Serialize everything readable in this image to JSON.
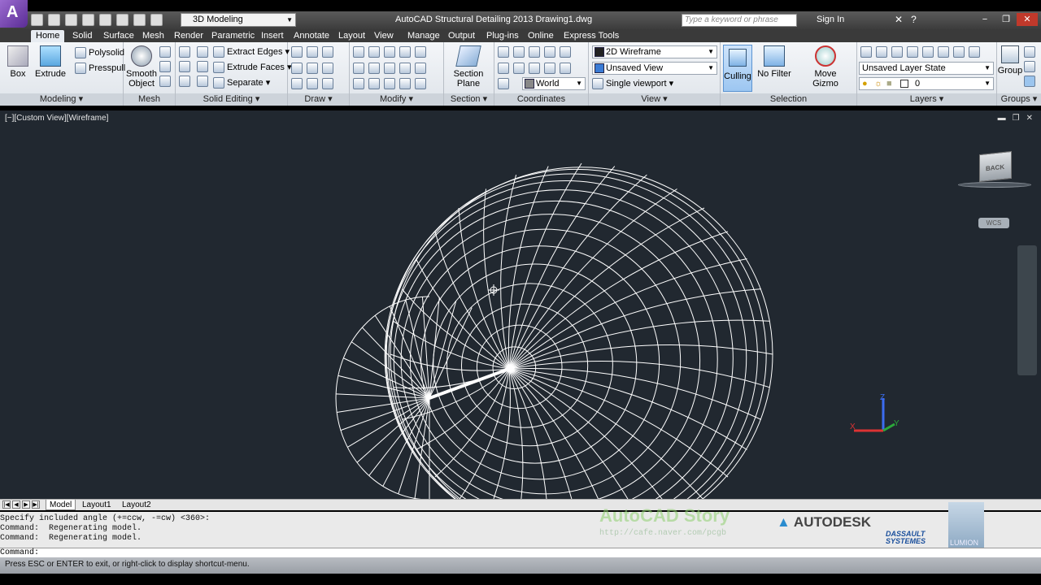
{
  "title_bar": {
    "logo": "A",
    "workspace": "3D Modeling",
    "app_title": "AutoCAD Structural Detailing 2013      Drawing1.dwg",
    "search_placeholder": "Type a keyword or phrase",
    "sign_in": "Sign In"
  },
  "tabs": [
    "Home",
    "Solid",
    "Surface",
    "Mesh",
    "Render",
    "Parametric",
    "Insert",
    "Annotate",
    "Layout",
    "View",
    "Manage",
    "Output",
    "Plug-ins",
    "Online",
    "Express Tools"
  ],
  "ribbon": {
    "modeling": {
      "label": "Modeling ▾",
      "box": "Box",
      "extrude": "Extrude",
      "polysolid": "Polysolid",
      "presspull": "Presspull"
    },
    "mesh": {
      "label": "Mesh",
      "smooth_object": "Smooth Object"
    },
    "solid_editing": {
      "label": "Solid Editing ▾",
      "extract_edges": "Extract Edges ▾",
      "extrude_faces": "Extrude Faces ▾",
      "separate": "Separate ▾"
    },
    "draw": {
      "label": "Draw ▾"
    },
    "modify": {
      "label": "Modify ▾"
    },
    "section": {
      "label": "Section ▾",
      "section_plane": "Section Plane"
    },
    "coordinates": {
      "label": "Coordinates",
      "world": "World"
    },
    "view": {
      "label": "View ▾",
      "visual_style": "2D Wireframe",
      "saved_view": "Unsaved View",
      "viewport": "Single viewport ▾"
    },
    "selection": {
      "label": "Selection",
      "culling": "Culling",
      "no_filter": "No Filter",
      "move_gizmo": "Move Gizmo"
    },
    "layers": {
      "label": "Layers ▾",
      "layer_state": "Unsaved Layer State",
      "current_layer": "0"
    },
    "groups": {
      "label": "Groups ▾",
      "group": "Group"
    }
  },
  "viewport": {
    "label": "[−][Custom View][Wireframe]",
    "viewcube": "BACK",
    "wcs": "WCS",
    "axis_z": "Z",
    "axis_x": "X",
    "axis_y": "Y"
  },
  "layout_tabs": [
    "Model",
    "Layout1",
    "Layout2"
  ],
  "command_history": [
    "Specify included angle (+=ccw, -=cw) <360>:",
    "Command:  Regenerating model.",
    "Command:  Regenerating model."
  ],
  "command_prompt": "Command:",
  "status_text": "Press ESC or ENTER to exit, or right-click to display shortcut-menu.",
  "watermark": {
    "text": "AutoCAD Story",
    "url": "http://cafe.naver.com/pcgb"
  },
  "logos": {
    "autodesk": "AUTODESK",
    "dassault_line1": "DASSAULT",
    "dassault_line2": "SYSTEMES",
    "lumion": "LUMION"
  },
  "colors": {
    "viewport_bg": "#212830",
    "wireframe": "#ffffff",
    "accent": "#5a2c95"
  }
}
